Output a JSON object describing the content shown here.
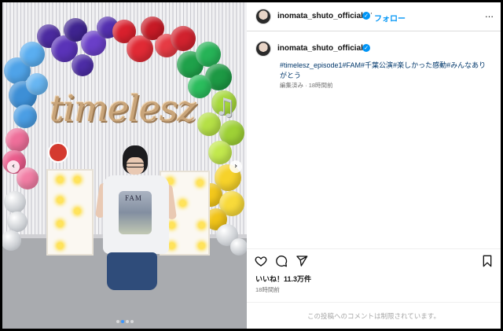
{
  "post": {
    "username": "inomata_shuto_official",
    "follow_label": "フォロー",
    "more_label": "…",
    "caption": "#timelesz_episode1#FAM#千葉公演#楽しかった感動#みんなありがとう",
    "edited_label": "編集済み",
    "edited_time": "18時間前",
    "likes": "いいね！11.3万件",
    "time": "18時間前",
    "comments_disabled": "この投稿へのコメントは制限されています。"
  },
  "photo": {
    "balloon_text": "timelesz",
    "letters": "FAM",
    "shirt_text": "FAM",
    "prev_label": "‹",
    "next_label": "›",
    "carousel_total": 4,
    "carousel_active": 1
  },
  "icons": {
    "verified": "verified-badge-icon",
    "like": "heart-icon",
    "comment": "comment-icon",
    "share": "share-icon",
    "save": "bookmark-icon"
  },
  "colors": {
    "link": "#00376b",
    "accent": "#0095f6",
    "muted": "#737373"
  }
}
